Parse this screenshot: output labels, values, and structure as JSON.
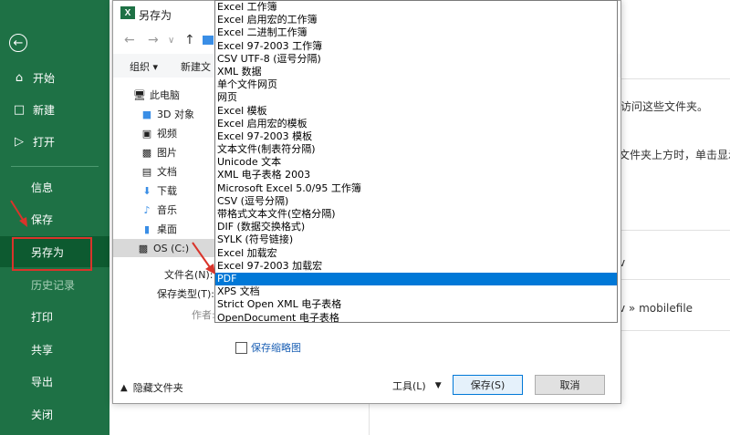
{
  "backstage": {
    "items": [
      {
        "label": "开始",
        "icon": "home-icon"
      },
      {
        "label": "新建",
        "icon": "new-doc-icon"
      },
      {
        "label": "打开",
        "icon": "open-folder-icon"
      },
      {
        "label": "信息"
      },
      {
        "label": "保存"
      },
      {
        "label": "另存为"
      },
      {
        "label": "历史记录"
      },
      {
        "label": "打印"
      },
      {
        "label": "共享"
      },
      {
        "label": "导出"
      },
      {
        "label": "关闭"
      }
    ],
    "accent": "#1e7145"
  },
  "background": {
    "text1": "访问这些文件夹。",
    "text2": "文件夹上方时，单击显示的",
    "text3": "v",
    "text4": "v » mobilefile"
  },
  "dialog": {
    "title": "另存为",
    "app_icon_letter": "X",
    "toolbar": {
      "organize": "组织 ▾",
      "new_folder": "新建文"
    },
    "nav": [
      {
        "label": "此电脑",
        "icon": "computer-icon"
      },
      {
        "label": "3D 对象",
        "icon": "cube-icon"
      },
      {
        "label": "视频",
        "icon": "video-icon"
      },
      {
        "label": "图片",
        "icon": "image-icon"
      },
      {
        "label": "文档",
        "icon": "document-icon"
      },
      {
        "label": "下载",
        "icon": "download-icon"
      },
      {
        "label": "音乐",
        "icon": "music-icon"
      },
      {
        "label": "桌面",
        "icon": "desktop-icon"
      },
      {
        "label": "OS (C:)",
        "icon": "drive-icon"
      }
    ],
    "fields": {
      "filename_label": "文件名(N):",
      "filetype_label": "保存类型(T):",
      "author_label": "作者:"
    },
    "thumbnail_checkbox": "保存缩略图",
    "hide_folders": "隐藏文件夹",
    "tools": "工具(L)",
    "save_button": "保存(S)",
    "cancel_button": "取消"
  },
  "file_types": {
    "selected": "PDF",
    "options": [
      "Excel 工作簿",
      "Excel 启用宏的工作簿",
      "Excel 二进制工作簿",
      "Excel 97-2003 工作簿",
      "CSV UTF-8 (逗号分隔)",
      "XML 数据",
      "单个文件网页",
      "网页",
      "Excel 模板",
      "Excel 启用宏的模板",
      "Excel 97-2003 模板",
      "文本文件(制表符分隔)",
      "Unicode 文本",
      "XML 电子表格 2003",
      "Microsoft Excel 5.0/95 工作簿",
      "CSV (逗号分隔)",
      "带格式文本文件(空格分隔)",
      "DIF (数据交换格式)",
      "SYLK (符号链接)",
      "Excel 加载宏",
      "Excel 97-2003 加载宏",
      "PDF",
      "XPS 文档",
      "Strict Open XML 电子表格",
      "OpenDocument 电子表格"
    ]
  }
}
